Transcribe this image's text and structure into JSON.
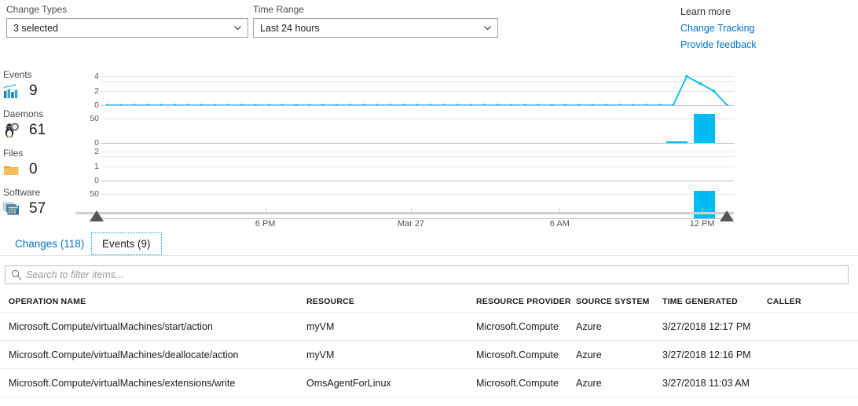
{
  "filters": {
    "change_types": {
      "label": "Change Types",
      "value": "3 selected"
    },
    "time_range": {
      "label": "Time Range",
      "value": "Last 24 hours"
    }
  },
  "links": {
    "heading": "Learn more",
    "items": [
      {
        "label": "Change Tracking"
      },
      {
        "label": "Provide feedback"
      }
    ]
  },
  "metrics": [
    {
      "title": "Events",
      "value": "9",
      "icon": "bar-chart-icon"
    },
    {
      "title": "Daemons",
      "value": "61",
      "icon": "daemon-penguin-icon"
    },
    {
      "title": "Files",
      "value": "0",
      "icon": "folder-icon"
    },
    {
      "title": "Software",
      "value": "57",
      "icon": "software-icon"
    }
  ],
  "chart_data": {
    "type": "bar",
    "title": "",
    "xlabel": "",
    "ylabel": "",
    "grid": true,
    "legend_position": "none",
    "accent_color": "#00bcf2",
    "x_tick_labels": [
      "6 PM",
      "Mar 27",
      "6 AM",
      "12 PM"
    ],
    "x_tick_positions_pct": [
      26,
      49,
      72.5,
      95
    ],
    "range_handles": [
      "start",
      "end"
    ],
    "series": [
      {
        "name": "Events",
        "type": "line",
        "ylim": [
          0,
          5
        ],
        "yticks": [
          0,
          2,
          4
        ],
        "values": [
          0,
          0,
          0,
          0,
          0,
          0,
          0,
          0,
          0,
          0,
          0,
          0,
          0,
          0,
          0,
          0,
          0,
          0,
          0,
          0,
          0,
          0,
          0,
          0,
          0,
          0,
          0,
          0,
          0,
          0,
          0,
          0,
          0,
          0,
          0,
          0,
          0,
          0,
          0,
          0,
          0,
          0,
          0,
          4,
          3,
          2,
          0
        ]
      },
      {
        "name": "Daemons",
        "type": "bar",
        "ylim": [
          0,
          75
        ],
        "yticks": [
          0,
          50
        ],
        "values": [
          0,
          0,
          0,
          0,
          0,
          0,
          0,
          0,
          0,
          0,
          0,
          0,
          0,
          0,
          0,
          0,
          0,
          0,
          0,
          0,
          0,
          0,
          0,
          0,
          0,
          0,
          0,
          0,
          0,
          0,
          0,
          0,
          0,
          0,
          0,
          0,
          0,
          0,
          0,
          0,
          0,
          0,
          2,
          0,
          61,
          0,
          0
        ]
      },
      {
        "name": "Files",
        "type": "bar",
        "ylim": [
          0,
          2.5
        ],
        "yticks": [
          0,
          1,
          2
        ],
        "values": [
          0,
          0,
          0,
          0,
          0,
          0,
          0,
          0,
          0,
          0,
          0,
          0,
          0,
          0,
          0,
          0,
          0,
          0,
          0,
          0,
          0,
          0,
          0,
          0,
          0,
          0,
          0,
          0,
          0,
          0,
          0,
          0,
          0,
          0,
          0,
          0,
          0,
          0,
          0,
          0,
          0,
          0,
          0,
          0,
          0,
          0,
          0
        ]
      },
      {
        "name": "Software",
        "type": "bar",
        "ylim": [
          0,
          75
        ],
        "yticks": [
          0,
          50
        ],
        "values": [
          0,
          0,
          0,
          0,
          0,
          0,
          0,
          0,
          0,
          0,
          0,
          0,
          0,
          0,
          0,
          0,
          0,
          0,
          0,
          0,
          0,
          0,
          0,
          0,
          0,
          0,
          0,
          0,
          0,
          0,
          0,
          0,
          0,
          0,
          0,
          0,
          0,
          0,
          0,
          0,
          0,
          0,
          0,
          0,
          57,
          0,
          0
        ]
      }
    ]
  },
  "tabs": [
    {
      "label": "Changes (118)",
      "active": false
    },
    {
      "label": "Events (9)",
      "active": true
    }
  ],
  "search": {
    "placeholder": "Search to filter items...",
    "value": "",
    "icon": "search-icon"
  },
  "table": {
    "columns": [
      "OPERATION NAME",
      "RESOURCE",
      "RESOURCE PROVIDER",
      "SOURCE SYSTEM",
      "TIME GENERATED",
      "CALLER"
    ],
    "rows": [
      {
        "operation_name": "Microsoft.Compute/virtualMachines/start/action",
        "resource": "myVM",
        "resource_provider": "Microsoft.Compute",
        "source_system": "Azure",
        "time_generated": "3/27/2018 12:17 PM",
        "caller": ""
      },
      {
        "operation_name": "Microsoft.Compute/virtualMachines/deallocate/action",
        "resource": "myVM",
        "resource_provider": "Microsoft.Compute",
        "source_system": "Azure",
        "time_generated": "3/27/2018 12:16 PM",
        "caller": ""
      },
      {
        "operation_name": "Microsoft.Compute/virtualMachines/extensions/write",
        "resource": "OmsAgentForLinux",
        "resource_provider": "Microsoft.Compute",
        "source_system": "Azure",
        "time_generated": "3/27/2018 11:03 AM",
        "caller": ""
      }
    ]
  }
}
